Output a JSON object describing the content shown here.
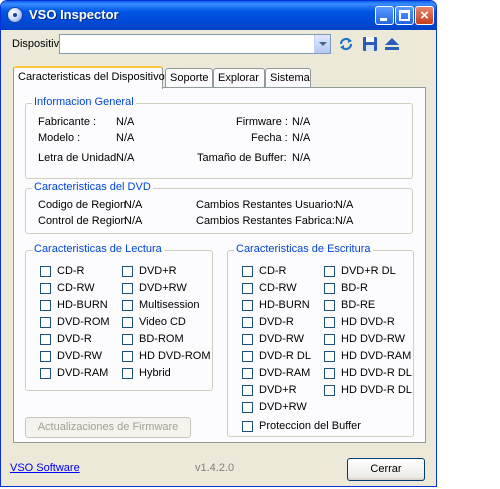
{
  "window": {
    "title": "VSO Inspector"
  },
  "toolbar": {
    "device_label": "Dispositivo",
    "device_value": ""
  },
  "tabs": [
    "Caracteristicas del Dispositivo",
    "Soporte",
    "Explorar",
    "Sistema"
  ],
  "general": {
    "title": "Informacion General",
    "fabricante_label": "Fabricante :",
    "fabricante_value": "N/A",
    "firmware_label": "Firmware :",
    "firmware_value": "N/A",
    "modelo_label": "Modelo :",
    "modelo_value": "N/A",
    "fecha_label": "Fecha :",
    "fecha_value": "N/A",
    "letra_label": "Letra de Unidad",
    "letra_value": "N/A",
    "buffer_label": "Tamaño de Buffer:",
    "buffer_value": "N/A"
  },
  "dvd": {
    "title": "Caracteristicas del DVD",
    "region_code_label": "Codigo de Region",
    "region_code_value": "N/A",
    "user_changes_label": "Cambios Restantes Usuario:",
    "user_changes_value": "N/A",
    "region_control_label": "Control de Region",
    "region_control_value": "N/A",
    "factory_changes_label": "Cambios Restantes Fabrica:",
    "factory_changes_value": "N/A"
  },
  "read": {
    "title": "Caracteristicas de Lectura",
    "col1": [
      "CD-R",
      "CD-RW",
      "HD-BURN",
      "DVD-ROM",
      "DVD-R",
      "DVD-RW",
      "DVD-RAM"
    ],
    "col2": [
      "DVD+R",
      "DVD+RW",
      "Multisession",
      "Video CD",
      "BD-ROM",
      "HD DVD-ROM",
      "Hybrid"
    ]
  },
  "write": {
    "title": "Caracteristicas de Escritura",
    "col1": [
      "CD-R",
      "CD-RW",
      "HD-BURN",
      "DVD-R",
      "DVD-RW",
      "DVD-R DL",
      "DVD-RAM",
      "DVD+R",
      "DVD+RW"
    ],
    "col2": [
      "DVD+R DL",
      "BD-R",
      "BD-RE",
      "HD DVD-R",
      "HD DVD-RW",
      "HD DVD-RAM",
      "HD DVD-R DL",
      "HD DVD-R DL"
    ],
    "buffer_protection": "Proteccion del Buffer"
  },
  "footer": {
    "firmware_button": "Actualizaciones de Firmware",
    "link": "VSO Software",
    "version": "v1.4.2.0",
    "close_button": "Cerrar"
  }
}
